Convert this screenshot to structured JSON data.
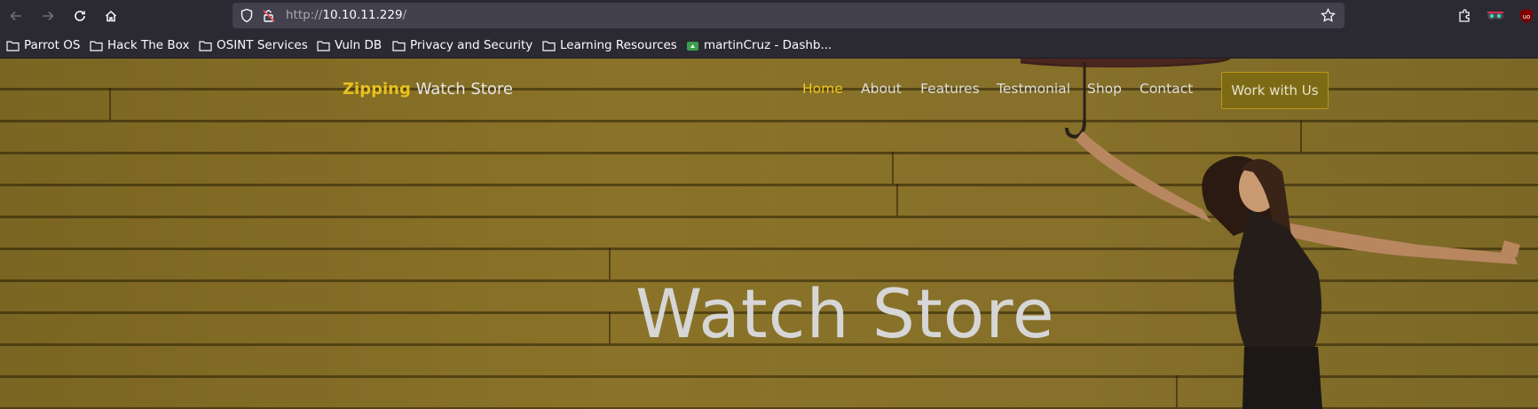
{
  "browser": {
    "url_prefix": "http://",
    "url_host": "10.10.11.229",
    "url_suffix": "/"
  },
  "bookmarks": [
    {
      "label": "Parrot OS"
    },
    {
      "label": "Hack The Box"
    },
    {
      "label": "OSINT Services"
    },
    {
      "label": "Vuln DB"
    },
    {
      "label": "Privacy and Security"
    },
    {
      "label": "Learning Resources"
    },
    {
      "label": "martinCruz - Dashb..."
    }
  ],
  "site": {
    "brand_accent": "Zipping",
    "brand_rest": " Watch Store",
    "nav": [
      {
        "label": "Home",
        "active": true
      },
      {
        "label": "About"
      },
      {
        "label": "Features"
      },
      {
        "label": "Testmonial"
      },
      {
        "label": "Shop"
      },
      {
        "label": "Contact"
      }
    ],
    "cta_label": "Work with Us",
    "hero_title": "Watch Store"
  },
  "colors": {
    "accent": "#e7c11f",
    "background_wood": "#86702a",
    "browser_chrome": "#2b2a33"
  }
}
